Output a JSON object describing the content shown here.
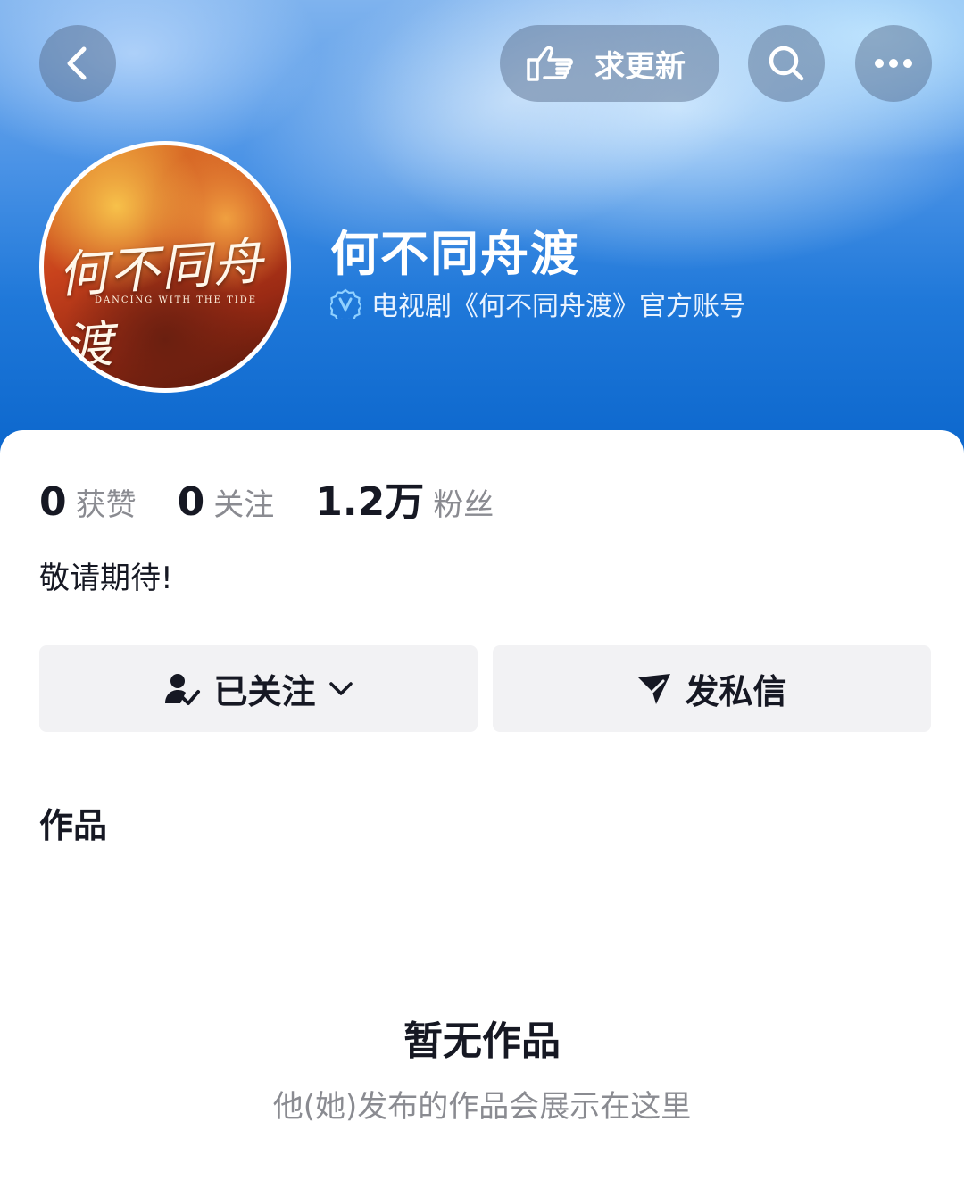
{
  "header": {
    "update_label": "求更新"
  },
  "profile": {
    "avatar_title": "何不同舟渡",
    "avatar_subtitle": "DANCING WITH THE TIDE",
    "name": "何不同舟渡",
    "verification": "电视剧《何不同舟渡》官方账号"
  },
  "stats": [
    {
      "value": "0",
      "label": "获赞"
    },
    {
      "value": "0",
      "label": "关注"
    },
    {
      "value": "1.2万",
      "label": "粉丝"
    }
  ],
  "bio": "敬请期待!",
  "actions": {
    "follow_label": "已关注",
    "message_label": "发私信"
  },
  "tabs": {
    "works_label": "作品"
  },
  "empty_state": {
    "title": "暂无作品",
    "description": "他(她)发布的作品会展示在这里"
  },
  "colors": {
    "banner_blue": "#1f78d9",
    "text_primary": "#161823",
    "text_secondary": "#8a8b91",
    "button_bg": "#f2f2f4"
  }
}
